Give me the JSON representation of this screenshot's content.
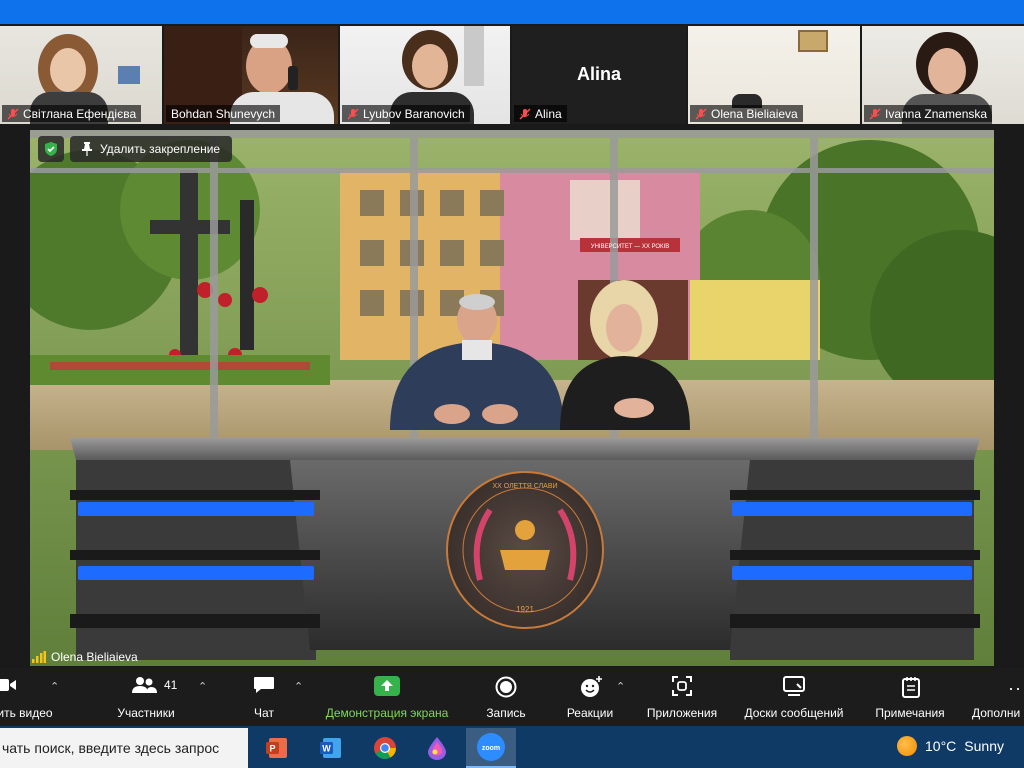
{
  "gallery": {
    "tiles": [
      {
        "name": "Світлана Ефендієва",
        "muted": true
      },
      {
        "name": "Bohdan Shunevych",
        "muted": false
      },
      {
        "name": "Lyubov Baranovich",
        "muted": true
      },
      {
        "name": "Alina",
        "muted": true,
        "display": "Alina"
      },
      {
        "name": "Olena Bieliaieva",
        "muted": true
      },
      {
        "name": "Ivanna Znamenska",
        "muted": true
      }
    ]
  },
  "main": {
    "unpin_label": "Удалить закрепление",
    "active_speaker": "Olena Bieliaieva",
    "emblem_top": "ХХ ОЛЕТТЯ СЛАВИ",
    "emblem_year": "1921",
    "building_sign": "УНІВЕРСИТЕТ — ХХ РОКІВ"
  },
  "toolbar": {
    "video_label": "ить видео",
    "participants_label": "Участники",
    "participants_count": "41",
    "chat_label": "Чат",
    "share_label": "Демонстрация экрана",
    "record_label": "Запись",
    "reactions_label": "Реакции",
    "apps_label": "Приложения",
    "whiteboards_label": "Доски сообщений",
    "notes_label": "Примечания",
    "more_label": "Дополни"
  },
  "taskbar": {
    "search_text": "чать поиск, введите здесь запрос",
    "apps": [
      "powerpoint-icon",
      "word-icon",
      "chrome-icon",
      "paint-icon",
      "zoom-icon"
    ],
    "zoom_label": "zoom",
    "weather_temp": "10°C",
    "weather_desc": "Sunny"
  },
  "colors": {
    "zoom_blue": "#0e72ed",
    "share_green": "#7ed957",
    "desk_blue": "#1e6bff",
    "emblem_gold": "#e3a23c"
  }
}
